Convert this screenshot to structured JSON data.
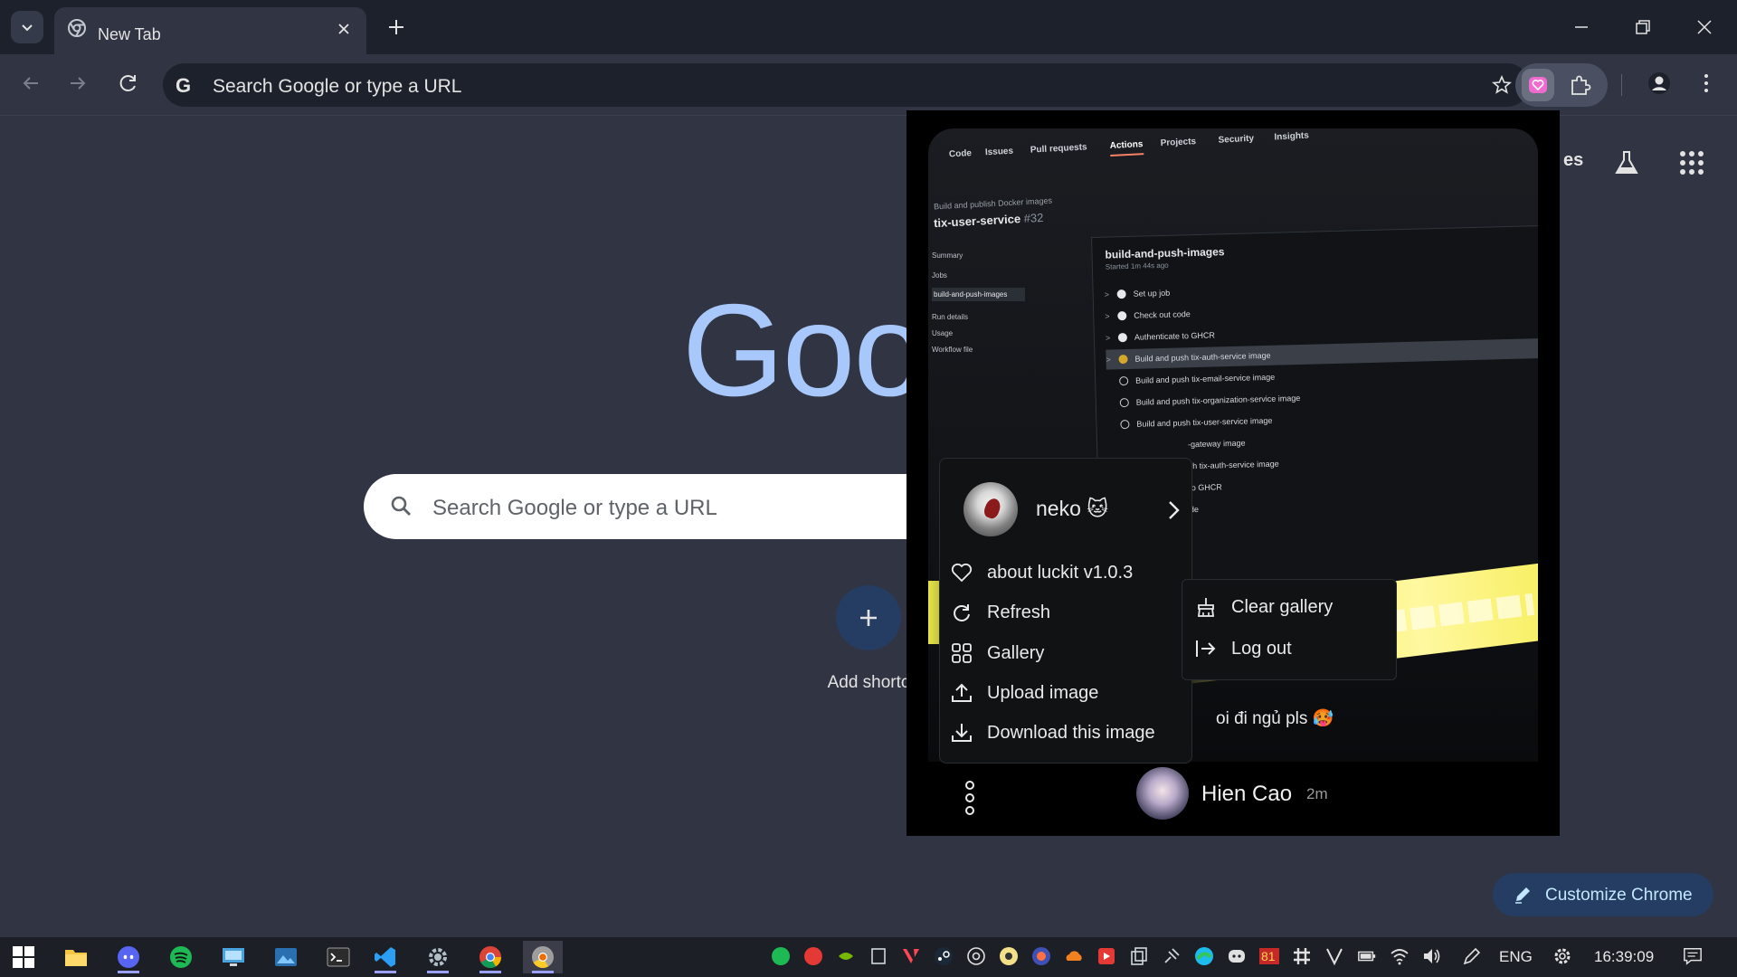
{
  "browser": {
    "tab_title": "New Tab",
    "omnibox_text": "Search Google or type a URL",
    "omnibox_prefix": "G"
  },
  "ntp": {
    "logo_text": "Goo",
    "search_placeholder": "Search Google or type a URL",
    "add_shortcut_label": "Add shortc",
    "top_link_partial": "es",
    "customize_label": "Customize Chrome"
  },
  "popup": {
    "screenshot": {
      "tabs": [
        "Code",
        "Issues",
        "Pull requests",
        "Actions",
        "Projects",
        "Security",
        "Insights"
      ],
      "breadcrumb": "Build and publish Docker images",
      "run_title": "tix-user-service",
      "run_number": "#32",
      "sidebar": [
        "Summary",
        "Jobs",
        "build-and-push-images",
        "Run details",
        "Usage",
        "Workflow file"
      ],
      "job_title": "build-and-push-images",
      "job_subtitle": "Started 1m 44s ago",
      "steps": [
        "Set up job",
        "Check out code",
        "Authenticate to GHCR",
        "Build and push tix-auth-service image",
        "Build and push tix-email-service image",
        "Build and push tix-organization-service image",
        "Build and push tix-user-service image",
        "-gateway image",
        "sh tix-auth-service image",
        "to GHCR",
        "de"
      ],
      "caption": "oi đi ngủ pls 🥵"
    },
    "menu": {
      "user_name": "neko 🐱",
      "items": [
        {
          "label": "about luckit v1.0.3",
          "icon": "heart-icon"
        },
        {
          "label": "Refresh",
          "icon": "refresh-icon"
        },
        {
          "label": "Gallery",
          "icon": "grid-icon"
        },
        {
          "label": "Upload image",
          "icon": "upload-icon"
        },
        {
          "label": "Download this image",
          "icon": "download-icon"
        }
      ],
      "submenu": [
        {
          "label": "Clear gallery",
          "icon": "clear-icon"
        },
        {
          "label": "Log out",
          "icon": "logout-icon"
        }
      ]
    },
    "sender": {
      "name": "Hien Cao",
      "time": "2m"
    }
  },
  "taskbar": {
    "language": "ENG",
    "clock": "16:39:09",
    "badge": "81"
  },
  "colors": {
    "page_bg": "#303443",
    "tabstrip_bg": "#1d212c",
    "accent_blue": "#a8c7fa",
    "customize_bg": "#253d63",
    "glow_yellow": "#f5f06a"
  }
}
